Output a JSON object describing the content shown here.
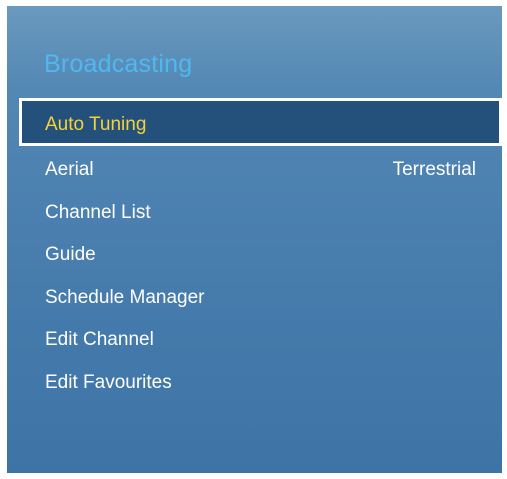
{
  "panel": {
    "title": "Broadcasting"
  },
  "menu": {
    "items": [
      {
        "label": "Auto Tuning",
        "value": "",
        "selected": true
      },
      {
        "label": "Aerial",
        "value": "Terrestrial",
        "selected": false
      },
      {
        "label": "Channel List",
        "value": "",
        "selected": false
      },
      {
        "label": "Guide",
        "value": "",
        "selected": false
      },
      {
        "label": "Schedule Manager",
        "value": "",
        "selected": false
      },
      {
        "label": "Edit Channel",
        "value": "",
        "selected": false
      },
      {
        "label": "Edit Favourites",
        "value": "",
        "selected": false
      }
    ]
  },
  "colors": {
    "title": "#4fb8f0",
    "selected_text": "#f4d23a",
    "selected_bg": "#24507c",
    "text": "#ffffff"
  }
}
